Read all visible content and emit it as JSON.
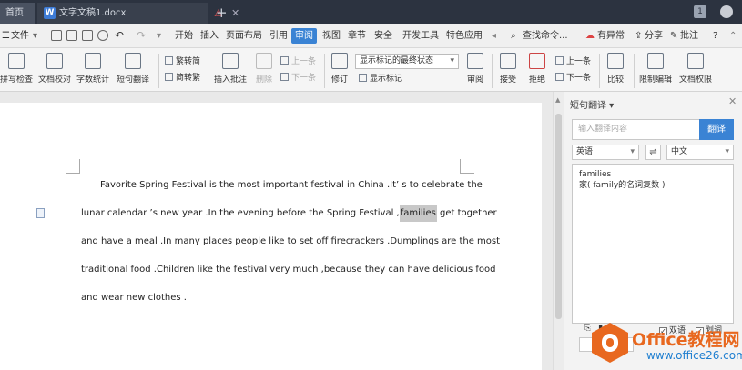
{
  "titlebar": {
    "home_tab": "首页",
    "doc_tab": "文字文稿1.docx",
    "doc_icon": "W",
    "warn_icon": "⚠",
    "close_icon": "✕",
    "new_tab_icon": "+",
    "badge": "1"
  },
  "menubar": {
    "file": "文件",
    "items": [
      "开始",
      "插入",
      "页面布局",
      "引用",
      "审阅",
      "视图",
      "章节",
      "安全",
      "开发工具",
      "特色应用"
    ],
    "search": "查找命令...",
    "right_items": [
      "有异常",
      "分享",
      "批注"
    ],
    "help": "?"
  },
  "ribbon": {
    "spell_check": "拼写检查",
    "doc_proof": "文档校对",
    "word_count": "字数统计",
    "short_translate": "短句翻译",
    "to_trad": "繁转简",
    "to_simp": "简转繁",
    "insert_comment": "插入批注",
    "delete": "删除",
    "prev": "上一条",
    "next": "下一条",
    "revise": "修订",
    "display_dropdown": "显示标记的最终状态",
    "show_markup": "显示标记",
    "review": "审阅",
    "accept": "接受",
    "reject": "拒绝",
    "prev2": "上一条",
    "next2": "下一条",
    "compare": "比较",
    "restrict_edit": "限制编辑",
    "doc_rights": "文档权限"
  },
  "document": {
    "lines": [
      "Favorite Spring Festival is the most important festival in China .It’ s to celebrate the",
      "lunar calendar   ’s new year .In the evening before the Spring Festival ,",
      "and have a meal .In many places people like to set off firecrackers .Dumplings are the most",
      "traditional food .Children like the festival very much ,because they can have delicious food",
      "and wear new clothes ."
    ],
    "highlight_word": "families",
    "line2_tail": " get together"
  },
  "panel": {
    "title": "短句翻译",
    "input_placeholder": "输入翻译内容",
    "translate_button": "翻译",
    "source_lang": "英语",
    "target_lang": "中文",
    "swap_icon": "⇌",
    "result_word": "families",
    "result_meaning": "家( family的名词复数 )",
    "bilingual": "双语",
    "segment": "划词"
  },
  "watermark": {
    "brand": "Office教程网",
    "url": "www.office26.com"
  }
}
